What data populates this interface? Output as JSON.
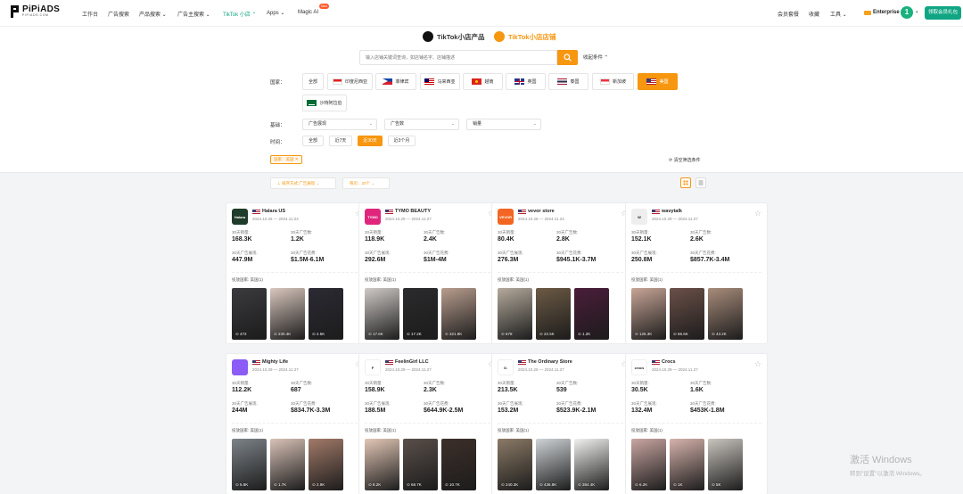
{
  "brand": {
    "name": "PiPiADS",
    "sub": "PIPIADS.COM"
  },
  "nav": {
    "items": [
      "工作台",
      "广告搜索",
      "产品搜索 ⌄",
      "广告主搜索 ⌄",
      "TikTok 小店 ⌃",
      "Apps ⌄",
      "Magic AI"
    ],
    "new_badge": "New",
    "right": [
      "会员套餐",
      "收藏",
      "工具 ⌄"
    ],
    "plan": "Enterprise",
    "avatar": "1",
    "get_vip": "领取会员礼包"
  },
  "switch": {
    "products": "TikTok小店产品",
    "stores": "TikTok小店店铺"
  },
  "search": {
    "placeholder": "输入店铺关键词查询，如店铺名字、店铺描述",
    "advanced": "收起条件 ⌃"
  },
  "filters": {
    "country_label": "国家：",
    "countries": [
      "全部",
      "印度尼西亚",
      "菲律宾",
      "马来西亚",
      "越南",
      "英国",
      "泰国",
      "新加坡",
      "美国",
      "沙特阿拉伯"
    ],
    "basic_label": "基础：",
    "basic_selects": [
      "广告展现",
      "广告数",
      "销量"
    ],
    "time_label": "时间：",
    "time": [
      "全部",
      "近7天",
      "近30天",
      "近3个月"
    ],
    "applied": "国家：美国  ✕",
    "clear": "清空筛选条件"
  },
  "toolbar": {
    "sort": "排序方式:广告展现",
    "per_page": "每页：20个"
  },
  "metric_labels": {
    "sales": "30天销量:",
    "ads": "30天广告数:",
    "impressions": "30天广告展现:",
    "spend": "30天广告花费:"
  },
  "country_text": "投放国家: 美国(1)",
  "stores": [
    {
      "name": "Halara US",
      "date": "2024.10.26 — 2024.11.24",
      "sales": "168.3K",
      "ads": "1.2K",
      "impressions": "447.9M",
      "spend": "$1.5M-6.1M",
      "logo_text": "Halara",
      "logo_color": "#1f3b2a",
      "views": [
        "472",
        "230.4K",
        "2.5K"
      ]
    },
    {
      "name": "TYMO BEAUTY",
      "date": "2024.10.29 — 2024.11.27",
      "sales": "118.9K",
      "ads": "2.4K",
      "impressions": "292.6M",
      "spend": "$1M-4M",
      "logo_text": "TYMO",
      "logo_color": "#e0267c",
      "views": [
        "17.6K",
        "17.2K",
        "321.8K"
      ]
    },
    {
      "name": "vevor store",
      "date": "2024.10.26 — 2024.11.24",
      "sales": "80.4K",
      "ads": "2.8K",
      "impressions": "276.3M",
      "spend": "$945.1K-3.7M",
      "logo_text": "VEVOR",
      "logo_color": "#f26522",
      "views": [
        "678",
        "22.5K",
        "1.2K"
      ]
    },
    {
      "name": "wavytalk",
      "date": "2024.10.29 — 2024.11.27",
      "sales": "152.1K",
      "ads": "2.6K",
      "impressions": "250.8M",
      "spend": "$857.7K-3.4M",
      "logo_text": "W",
      "logo_color": "#eeeeee",
      "views": [
        "125.3K",
        "56.6K",
        "43.2K"
      ]
    },
    {
      "name": "Mighty Life",
      "date": "2024.10.29 — 2024.11.27",
      "sales": "112.2K",
      "ads": "687",
      "impressions": "244M",
      "spend": "$834.7K-3.3M",
      "logo_text": "",
      "logo_color": "#8b5cf6",
      "views": [
        "5.8K",
        "1.7K",
        "2.9K"
      ]
    },
    {
      "name": "FeelinGirl LLC",
      "date": "2024.10.29 — 2024.11.27",
      "sales": "158.9K",
      "ads": "2.3K",
      "impressions": "188.5M",
      "spend": "$644.9K-2.5M",
      "logo_text": "F",
      "logo_color": "#ffffff",
      "views": [
        "8.2K",
        "68.7K",
        "10.7K"
      ]
    },
    {
      "name": "The Ordinary Store",
      "date": "2024.10.29 — 2024.11.27",
      "sales": "213.5K",
      "ads": "539",
      "impressions": "153.2M",
      "spend": "$523.9K-2.1M",
      "logo_text": "O.",
      "logo_color": "#ffffff",
      "views": [
        "240.3K",
        "436.8K",
        "384.4K"
      ]
    },
    {
      "name": "Crocs",
      "date": "2024.10.29 — 2024.11.27",
      "sales": "30.5K",
      "ads": "1.6K",
      "impressions": "132.4M",
      "spend": "$453K-1.8M",
      "logo_text": "crocs",
      "logo_color": "#ffffff",
      "views": [
        "6.2K",
        "1K",
        "5K"
      ]
    }
  ],
  "watermark": {
    "line1": "激活 Windows",
    "line2": "转到\"设置\"以激活 Windows。"
  }
}
